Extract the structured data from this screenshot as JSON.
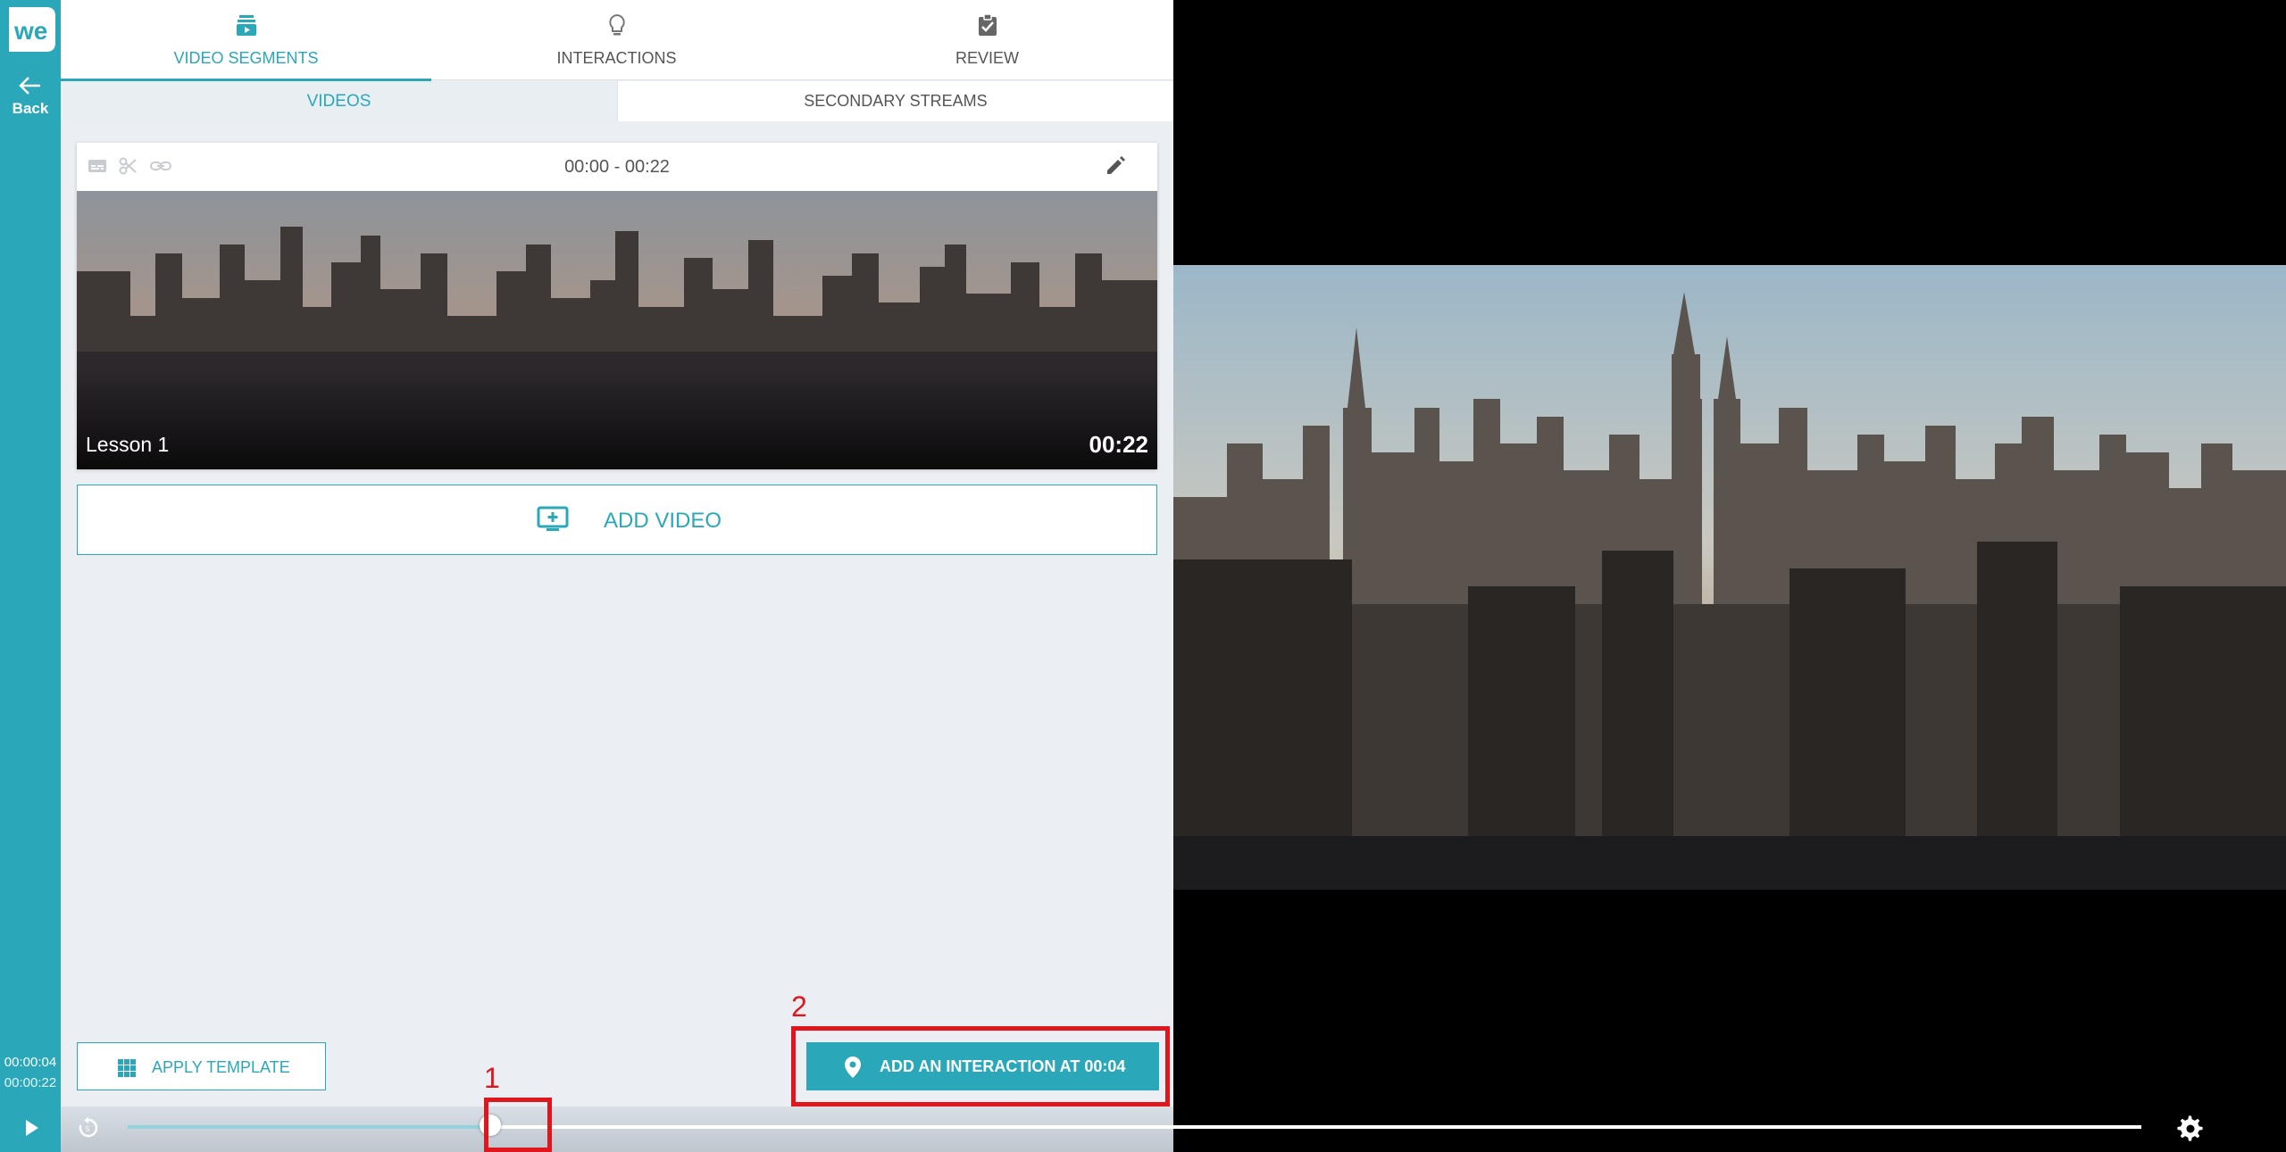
{
  "app": {
    "logo_text": "we",
    "back_label": "Back"
  },
  "playback": {
    "current_time": "00:00:04",
    "total_time": "00:00:22",
    "progress": 0.18
  },
  "top_tabs": [
    {
      "label": "VIDEO SEGMENTS",
      "icon": "video-stack-icon",
      "active": true
    },
    {
      "label": "INTERACTIONS",
      "icon": "lightbulb-icon",
      "active": false
    },
    {
      "label": "REVIEW",
      "icon": "clipboard-check-icon",
      "active": false
    }
  ],
  "sub_tabs": [
    {
      "label": "VIDEOS",
      "active": true
    },
    {
      "label": "SECONDARY STREAMS",
      "active": false
    }
  ],
  "segment": {
    "range": "00:00 - 00:22",
    "name": "Lesson 1",
    "duration": "00:22",
    "tools": [
      "subtitles-icon",
      "scissors-icon",
      "link-icon"
    ],
    "edit_icon": "pencil-icon"
  },
  "actions": {
    "add_video": "ADD VIDEO",
    "apply_template": "APPLY TEMPLATE",
    "add_interaction": "ADD AN INTERACTION AT 00:04"
  },
  "annotations": [
    {
      "number": "1"
    },
    {
      "number": "2"
    }
  ],
  "colors": {
    "accent": "#2aa8ba",
    "annotation": "#e0161e",
    "panel_bg": "#ebeef2"
  }
}
